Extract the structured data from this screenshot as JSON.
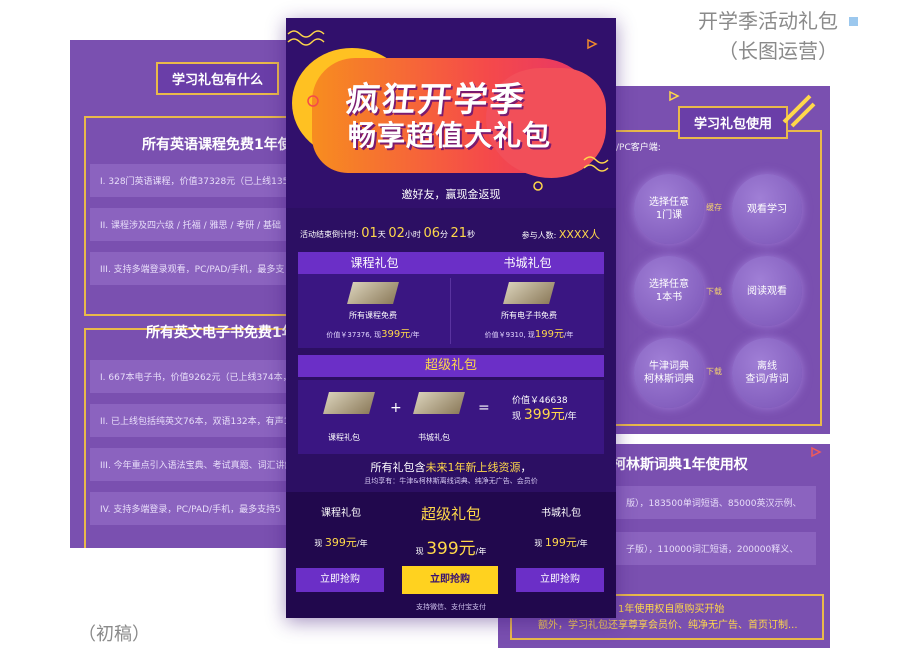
{
  "header": {
    "title": "开学季活动礼包",
    "subtitle": "（长图运营）"
  },
  "draft_label": "（初稿）",
  "left_panel": {
    "badge": "学习礼包有什么",
    "section1_title": "所有英语课程免费1年使",
    "section1_rows": [
      "I. 328门英语课程，价值37328元（已上线135门",
      "II. 课程涉及四六级 / 托福 / 雅思 / 考研 / 基础",
      "III. 支持多端登录观看，PC/PAD/手机，最多支"
    ],
    "section2_title": "所有英文电子书免费1年使",
    "section2_rows": [
      "I. 667本电子书，价值9262元（已上线374本，",
      "II. 已上线包括纯英文76本，双语132本，有声15",
      "III. 今年重点引入语法宝典、考试真题、词汇讲解",
      "IV. 支持多端登录，PC/PAD/手机，最多支持5"
    ]
  },
  "right_top_panel": {
    "badge": "学习礼包使用",
    "client_label": "/PC客户端:",
    "rows": [
      {
        "left": "选择任意\n1门课",
        "arrow": "缓存",
        "right": "观看学习"
      },
      {
        "left": "选择任意\n1本书",
        "arrow": "下载",
        "right": "阅读观看"
      },
      {
        "left": "牛津词典\n柯林斯词典",
        "arrow": "下载",
        "right": "离线\n查词/背词"
      }
    ]
  },
  "right_bottom_panel": {
    "title": "柯林斯词典1年使用权",
    "rows": [
      "版），183500单词短语、85000英汉示例、",
      "子版），110000词汇短语，200000释义、"
    ],
    "footer1": "1年使用权自愿购买开始",
    "footer2": "额外，学习礼包还享尊享会员价、纯净无广告、首页订制..."
  },
  "main": {
    "headline1": "疯狂开学季",
    "headline2": "畅享超值大礼包",
    "invite": "邀好友，赢现金返现",
    "countdown": {
      "label": "活动结束倒计时:",
      "days": "01",
      "day_unit": "天",
      "hours": "02",
      "hour_unit": "小时",
      "minutes": "06",
      "minute_unit": "分",
      "seconds": "21",
      "second_unit": "秒"
    },
    "participants": {
      "label": "参与人数:",
      "value": "XXXX人"
    },
    "gifts": [
      {
        "head": "课程礼包",
        "name": "所有课程免费",
        "price_prefix": "价值￥37376, 现",
        "price": "399元",
        "price_suffix": "/年"
      },
      {
        "head": "书城礼包",
        "name": "所有电子书免费",
        "price_prefix": "价值￥9310, 现",
        "price": "199元",
        "price_suffix": "/年"
      }
    ],
    "super": {
      "head": "超级礼包",
      "left_label": "课程礼包",
      "plus": "+",
      "right_label": "书城礼包",
      "equals": "=",
      "value_line": "价值￥46638",
      "now": "现",
      "price": "399元",
      "per": "/年"
    },
    "all_line_pre": "所有礼包含",
    "all_line_highlight": "未来1年新上线资源",
    "all_line_post": "，",
    "enjoy_line": "且均享有：牛津&柯林斯离线词典、纯净无广告、会员价",
    "bottom": {
      "cols": [
        {
          "name": "课程礼包",
          "now": "现",
          "price": "399元",
          "per": "/年",
          "buy": "立即抢购"
        },
        {
          "name": "超级礼包",
          "now": "现",
          "price": "399元",
          "per": "/年",
          "buy": "立即抢购"
        },
        {
          "name": "书城礼包",
          "now": "现",
          "price": "199元",
          "per": "/年",
          "buy": "立即抢购"
        }
      ],
      "pay": "支持微信、支付宝支付"
    }
  },
  "colors": {
    "bg_purple": "#2c0f63",
    "accent_yellow": "#ffd84a",
    "gold_frame": "#e9b94a",
    "panel_purple": "#7a50b0"
  }
}
